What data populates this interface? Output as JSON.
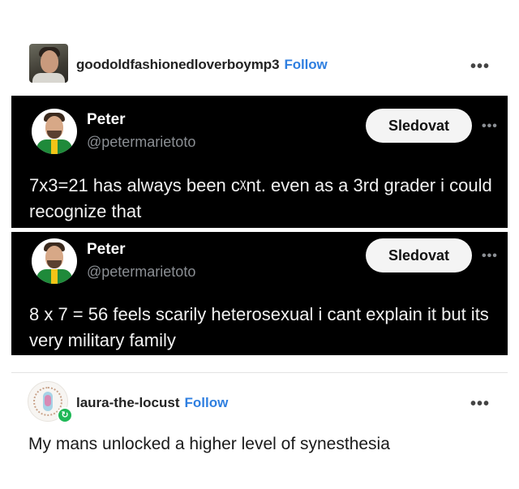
{
  "original_post": {
    "username": "goodoldfashionedloverboymp3",
    "follow_label": "Follow",
    "more_label": "•••"
  },
  "tweets": [
    {
      "name": "Peter",
      "handle": "@petermarietoto",
      "follow_button": "Sledovat",
      "more_label": "•••",
      "text": "7x3=21 has always been cᵡnt. even as a 3rd grader i could recognize that"
    },
    {
      "name": "Peter",
      "handle": "@petermarietoto",
      "follow_button": "Sledovat",
      "more_label": "•••",
      "text": "8 x 7 = 56 feels scarily heterosexual i cant explain it but its very military family"
    }
  ],
  "reblog": {
    "username": "laura-the-locust",
    "follow_label": "Follow",
    "more_label": "•••",
    "badge_icon": "↻",
    "text": "My mans unlocked a higher level of synesthesia"
  }
}
